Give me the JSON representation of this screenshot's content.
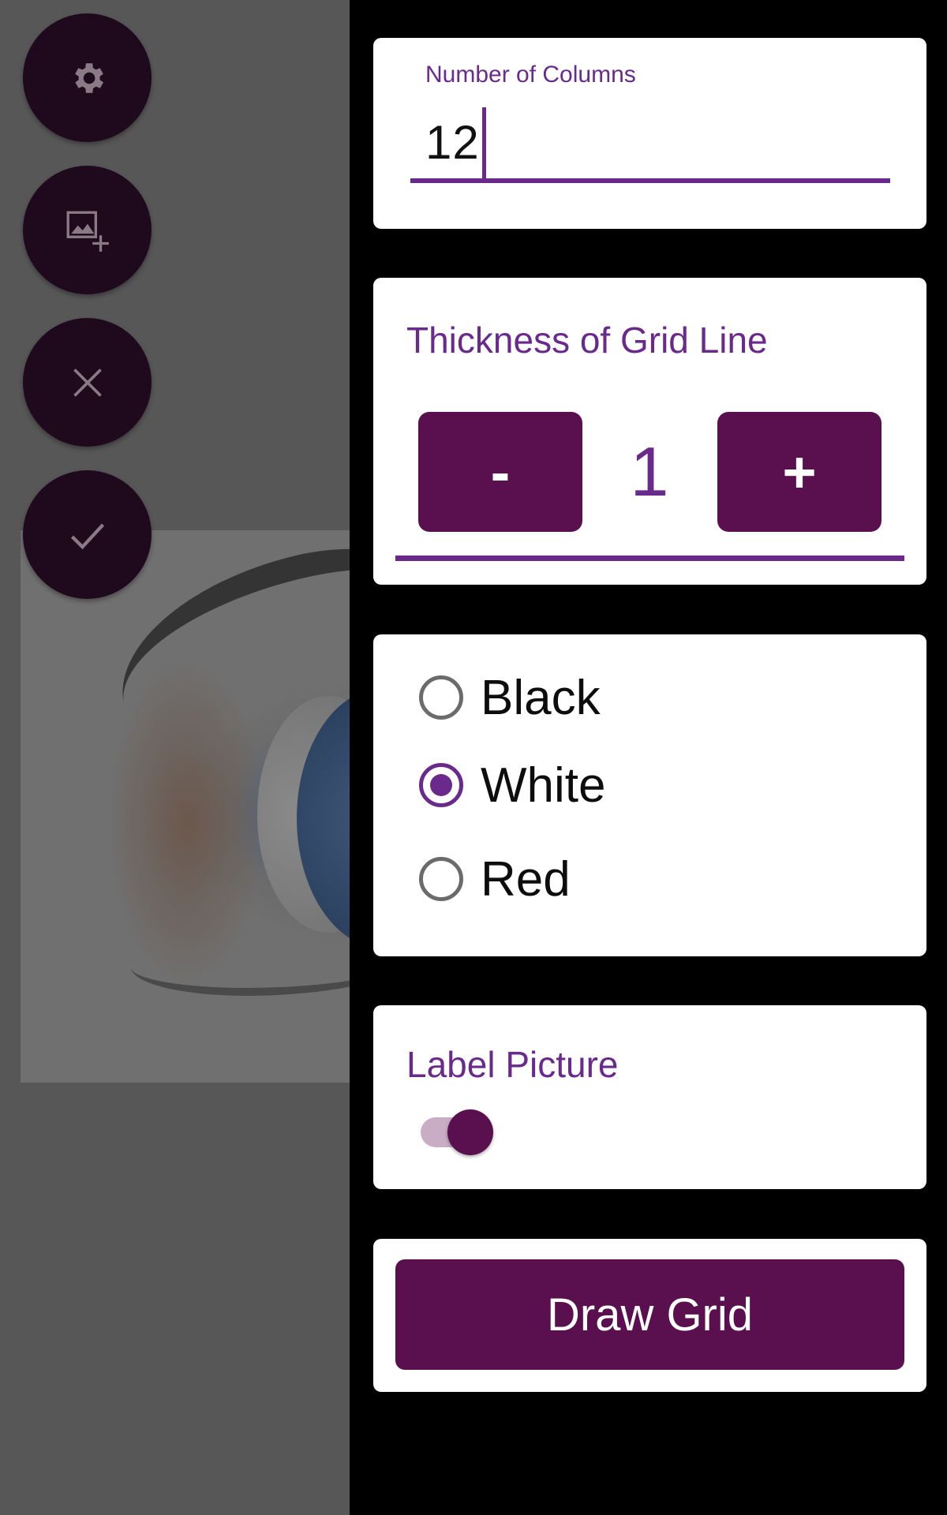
{
  "columns_field": {
    "label": "Number of Columns",
    "value": "12"
  },
  "thickness": {
    "title": "Thickness of Grid Line",
    "decrement_label": "-",
    "value": "1",
    "increment_label": "+"
  },
  "color_options": {
    "items": [
      {
        "label": "Black",
        "selected": false
      },
      {
        "label": "White",
        "selected": true
      },
      {
        "label": "Red",
        "selected": false
      }
    ]
  },
  "label_picture": {
    "title": "Label Picture",
    "enabled": true
  },
  "draw_button": {
    "label": "Draw Grid"
  },
  "fab_icons": [
    "gear-icon",
    "add-image-icon",
    "close-icon",
    "check-icon"
  ],
  "colors": {
    "accent": "#6a2a8c",
    "primary_dark": "#5a0f4e",
    "fab_bg": "#1f0a1d",
    "panel_bg": "#000000"
  }
}
